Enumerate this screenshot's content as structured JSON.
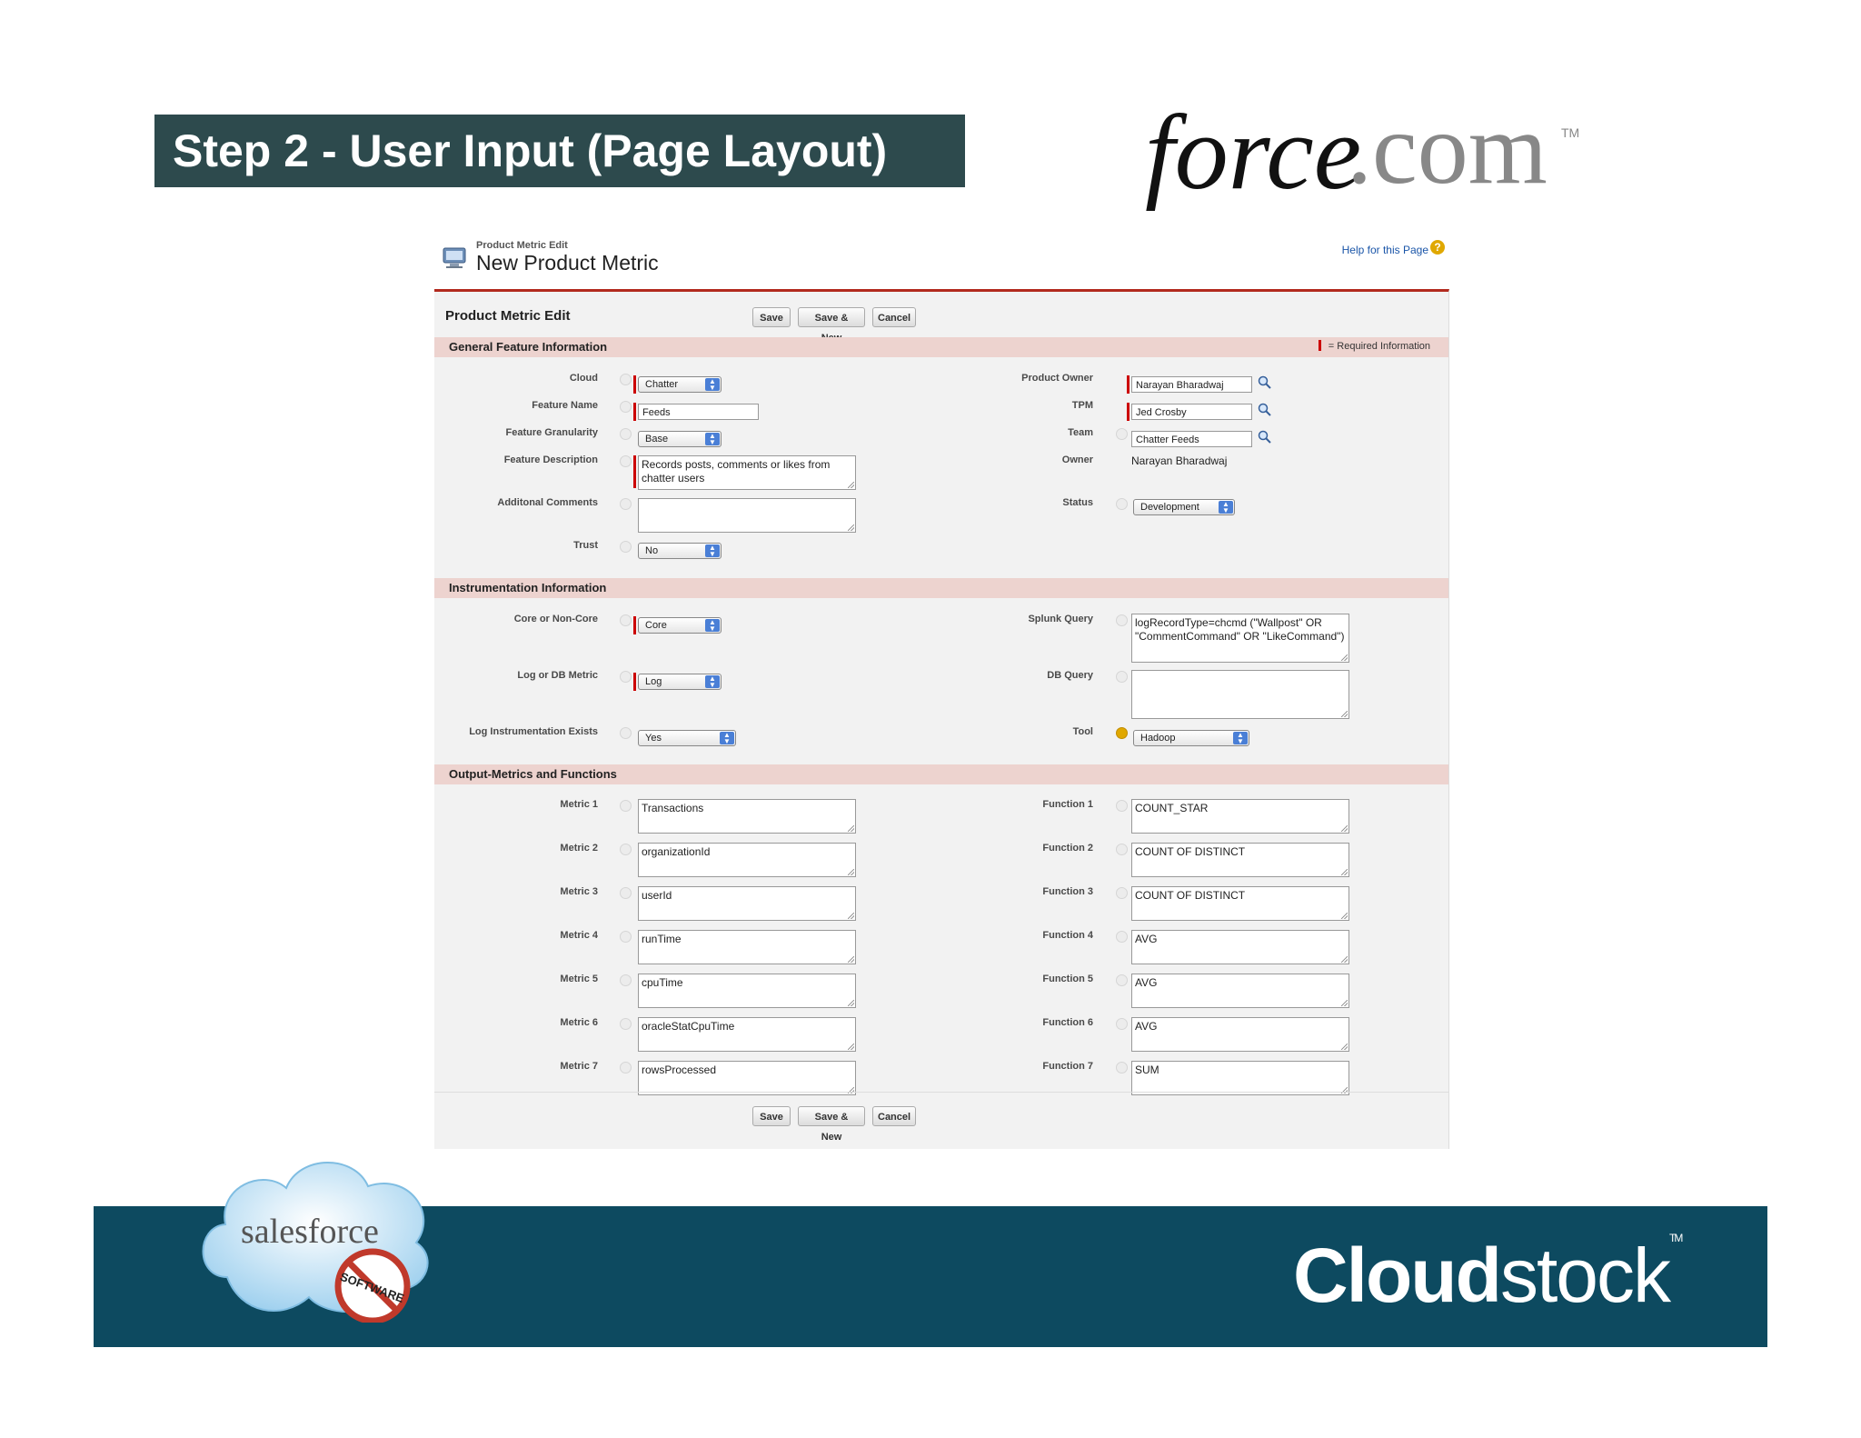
{
  "slide": {
    "title": "Step 2 - User Input (Page Layout)",
    "force_logo": {
      "word": "force",
      "suffix": ".com",
      "tm": "TM"
    },
    "cloudstock": {
      "bold": "Cloud",
      "rest": "stock",
      "tm": "TM"
    },
    "salesforce_logo": {
      "text": "salesforce",
      "badge": "SOFTWARE"
    }
  },
  "page": {
    "small_title": "Product Metric Edit",
    "big_title": "New Product Metric",
    "help_link": "Help for this Page",
    "edit_title": "Product Metric Edit",
    "buttons": {
      "save": "Save",
      "save_new": "Save & New",
      "cancel": "Cancel"
    },
    "required_legend": "= Required Information"
  },
  "sections": {
    "general": "General Feature Information",
    "instrumentation": "Instrumentation Information",
    "output": "Output-Metrics and Functions"
  },
  "general": {
    "cloud": {
      "label": "Cloud",
      "value": "Chatter"
    },
    "feature_name": {
      "label": "Feature Name",
      "value": "Feeds"
    },
    "granularity": {
      "label": "Feature Granularity",
      "value": "Base"
    },
    "description": {
      "label": "Feature Description",
      "value": "Records posts, comments or likes from chatter users"
    },
    "comments": {
      "label": "Additonal Comments",
      "value": ""
    },
    "trust": {
      "label": "Trust",
      "value": "No"
    },
    "product_owner": {
      "label": "Product Owner",
      "value": "Narayan Bharadwaj"
    },
    "tpm": {
      "label": "TPM",
      "value": "Jed Crosby"
    },
    "team": {
      "label": "Team",
      "value": "Chatter Feeds"
    },
    "owner": {
      "label": "Owner",
      "value": "Narayan Bharadwaj"
    },
    "status": {
      "label": "Status",
      "value": "Development"
    }
  },
  "instrumentation": {
    "core": {
      "label": "Core or Non-Core",
      "value": "Core"
    },
    "log_db": {
      "label": "Log or DB Metric",
      "value": "Log"
    },
    "log_exists": {
      "label": "Log Instrumentation Exists",
      "value": "Yes"
    },
    "splunk": {
      "label": "Splunk Query",
      "value": "logRecordType=chcmd (\"Wallpost\" OR \"CommentCommand\" OR \"LikeCommand\")"
    },
    "db_query": {
      "label": "DB Query",
      "value": ""
    },
    "tool": {
      "label": "Tool",
      "value": "Hadoop"
    }
  },
  "output": {
    "metrics": [
      {
        "label": "Metric 1",
        "value": "Transactions"
      },
      {
        "label": "Metric 2",
        "value": "organizationId"
      },
      {
        "label": "Metric 3",
        "value": "userId"
      },
      {
        "label": "Metric 4",
        "value": "runTime"
      },
      {
        "label": "Metric 5",
        "value": "cpuTime"
      },
      {
        "label": "Metric 6",
        "value": "oracleStatCpuTime"
      },
      {
        "label": "Metric 7",
        "value": "rowsProcessed"
      }
    ],
    "functions": [
      {
        "label": "Function 1",
        "value": "COUNT_STAR"
      },
      {
        "label": "Function 2",
        "value": "COUNT OF DISTINCT"
      },
      {
        "label": "Function 3",
        "value": "COUNT OF DISTINCT"
      },
      {
        "label": "Function 4",
        "value": "AVG"
      },
      {
        "label": "Function 5",
        "value": "AVG"
      },
      {
        "label": "Function 6",
        "value": "AVG"
      },
      {
        "label": "Function 7",
        "value": "SUM"
      }
    ]
  }
}
